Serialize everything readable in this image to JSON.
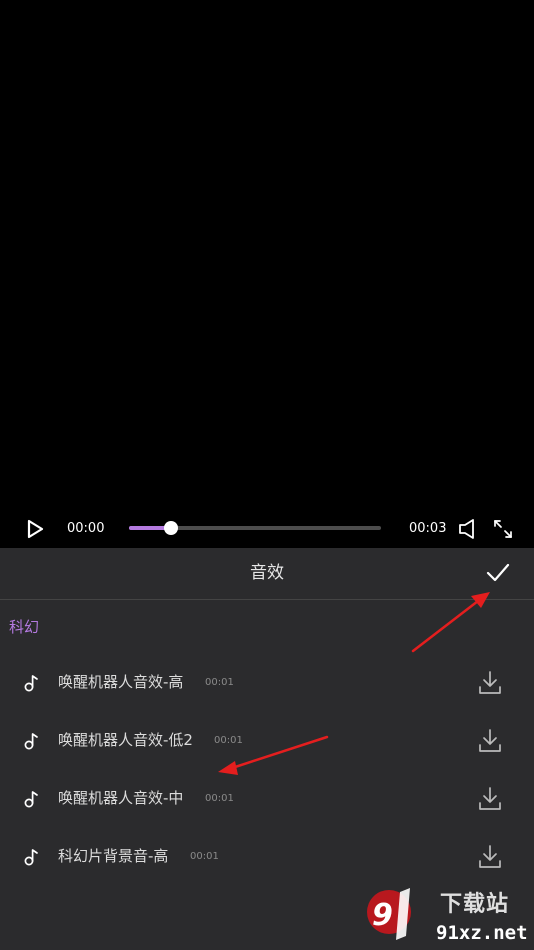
{
  "player": {
    "current_time": "00:00",
    "total_time": "00:03",
    "progress": 0.167,
    "accent": "#b47ae0"
  },
  "panel": {
    "title": "音效",
    "confirm_icon": "check-icon",
    "category": "科幻",
    "items": [
      {
        "name": "唤醒机器人音效-高",
        "duration": "00:01"
      },
      {
        "name": "唤醒机器人音效-低2",
        "duration": "00:01"
      },
      {
        "name": "唤醒机器人音效-中",
        "duration": "00:01"
      },
      {
        "name": "科幻片背景音-高",
        "duration": "00:01"
      }
    ]
  },
  "watermark": {
    "brand_cn": "下载站",
    "brand_url": "91xz.net"
  }
}
